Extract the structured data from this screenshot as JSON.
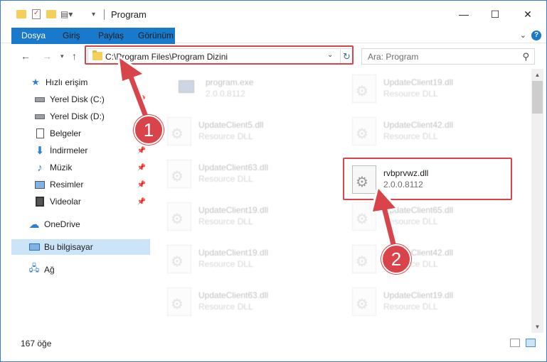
{
  "window": {
    "title": "Program",
    "minimize": "—",
    "maximize": "☐",
    "close": "✕"
  },
  "ribbon": {
    "tabs": [
      "Dosya",
      "Giriş",
      "Paylaş",
      "Görünüm"
    ],
    "help": "?"
  },
  "address": {
    "path": "C:\\Program Files\\Program Dizini",
    "search_placeholder": "Ara: Program"
  },
  "nav": {
    "items": [
      {
        "label": "Hızlı erişim",
        "icon": "star-icon"
      },
      {
        "label": "Yerel Disk (C:)",
        "icon": "drive-icon",
        "pinned": true
      },
      {
        "label": "Yerel Disk (D:)",
        "icon": "drive-icon"
      },
      {
        "label": "Belgeler",
        "icon": "documents-icon",
        "pinned": true
      },
      {
        "label": "İndirmeler",
        "icon": "download-icon",
        "pinned": true
      },
      {
        "label": "Müzik",
        "icon": "music-icon",
        "pinned": true
      },
      {
        "label": "Resimler",
        "icon": "pictures-icon",
        "pinned": true
      },
      {
        "label": "Videolar",
        "icon": "video-icon",
        "pinned": true
      },
      {
        "label": "OneDrive",
        "icon": "cloud-icon"
      },
      {
        "label": "Bu bilgisayar",
        "icon": "computer-icon",
        "selected": true
      },
      {
        "label": "Ağ",
        "icon": "network-icon"
      }
    ]
  },
  "files": [
    {
      "name": "program.exe",
      "desc": "2.0.0.8112",
      "faded": true
    },
    {
      "name": "UpdateClient19.dll",
      "desc": "Resource DLL",
      "faded": true
    },
    {
      "name": "UpdateClient5.dll",
      "desc": "Resource DLL",
      "faded": true
    },
    {
      "name": "UpdateClient42.dll",
      "desc": "Resource DLL",
      "faded": true
    },
    {
      "name": "UpdateClient63.dll",
      "desc": "Resource DLL",
      "faded": true
    },
    {
      "name": "rvbprvwz.dll",
      "desc": "2.0.0.8112",
      "faded": false
    },
    {
      "name": "UpdateClient19.dll",
      "desc": "Resource DLL",
      "faded": true
    },
    {
      "name": "UpdateClient65.dll",
      "desc": "Resource DLL",
      "faded": true
    },
    {
      "name": "UpdateClient19.dll",
      "desc": "Resource DLL",
      "faded": true
    },
    {
      "name": "UpdateClient42.dll",
      "desc": "Resource DLL",
      "faded": true
    },
    {
      "name": "UpdateClient63.dll",
      "desc": "Resource DLL",
      "faded": true
    },
    {
      "name": "UpdateClient19.dll",
      "desc": "Resource DLL",
      "faded": true
    }
  ],
  "status": {
    "count": "167 öğe"
  },
  "annotations": {
    "step1": "1",
    "step2": "2",
    "color": "#d9444a"
  }
}
